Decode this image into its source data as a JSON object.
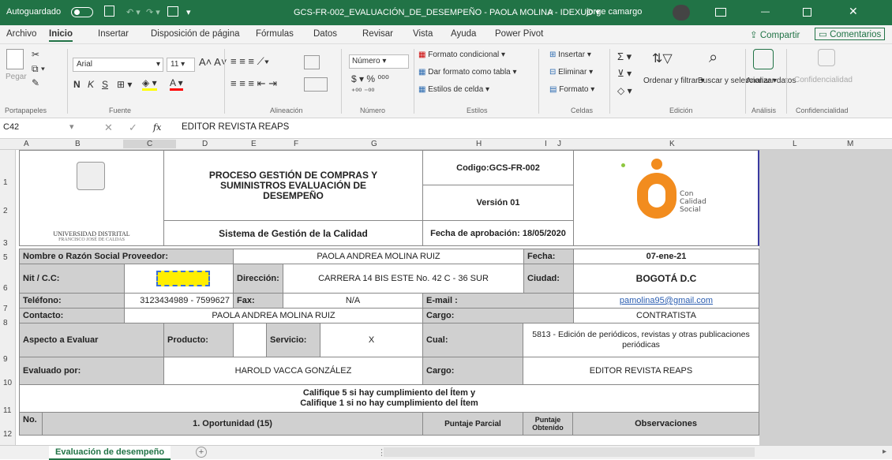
{
  "titlebar": {
    "autosave": "Autoguardado",
    "filename": "GCS-FR-002_EVALUACIÓN_DE_DESEMPEÑO - PAOLA MOLINA - IDEXUD ▾",
    "user": "jorge camargo",
    "bg": "#217346"
  },
  "menu": {
    "items": [
      "Archivo",
      "Inicio",
      "Insertar",
      "Disposición de página",
      "Fórmulas",
      "Datos",
      "Revisar",
      "Vista",
      "Ayuda",
      "Power Pivot"
    ],
    "share": "Compartir",
    "comments": "Comentarios"
  },
  "ribbon": {
    "paste": "Pegar",
    "font": "Arial",
    "size": "11",
    "bold": "N",
    "italic": "K",
    "underline": "S",
    "numfmt": "Número",
    "cond": "Formato condicional ▾",
    "astable": "Dar formato como tabla ▾",
    "styles": "Estilos de celda ▾",
    "insert": "Insertar ▾",
    "delete": "Eliminar ▾",
    "format": "Formato ▾",
    "sort": "Ordenar y filtrar ▾",
    "find": "Buscar y seleccionar ▾",
    "analyze": "Analizar datos",
    "conf": "Confidencialidad",
    "groups": [
      "Portapapeles",
      "Fuente",
      "Alineación",
      "Número",
      "Estilos",
      "Celdas",
      "Edición",
      "Análisis",
      "Confidencialidad"
    ]
  },
  "formula": {
    "cell": "C42",
    "fx": "fx",
    "value": "EDITOR REVISTA REAPS"
  },
  "columns": [
    "A",
    "B",
    "C",
    "D",
    "E",
    "F",
    "G",
    "H",
    "I",
    "J",
    "K",
    "L",
    "M"
  ],
  "rows": [
    "1",
    "2",
    "3",
    "5",
    "6",
    "7",
    "8",
    "9",
    "10",
    "11",
    "12"
  ],
  "sheet": {
    "univ1": "UNIVERSIDAD DISTRITAL",
    "univ2": "FRANCISCO JOSÉ DE CALDAS",
    "proc": "PROCESO GESTIÓN DE COMPRAS Y SUMINISTROS EVALUACIÓN DE DESEMPEÑO",
    "sgc": "Sistema de Gestión de la Calidad",
    "code": "Codigo:GCS-FR-002",
    "ver": "Versión 01",
    "date": "Fecha de aprobación: 18/05/2020",
    "logo_text": "Con Calidad Social",
    "l_name": "Nombre o Razón Social Proveedor:",
    "name": "PAOLA ANDREA MOLINA RUIZ",
    "l_fecha": "Fecha:",
    "fecha": "07-ene-21",
    "l_nit": "Nit / C.C:",
    "l_dir": "Dirección:",
    "dir": "CARRERA 14 BIS ESTE No. 42 C - 36 SUR",
    "l_city": "Ciudad:",
    "city": "BOGOTÁ D.C",
    "l_tel": "Teléfono:",
    "tel": "3123434989 - 7599627",
    "l_fax": "Fax:",
    "fax": "N/A",
    "l_mail": "E-mail :",
    "mail": "pamolina95@gmail.com",
    "l_contact": "Contacto:",
    "contact": "PAOLA ANDREA MOLINA RUIZ",
    "l_cargo": "Cargo:",
    "cargo1": "CONTRATISTA",
    "l_aspect": "Aspecto a Evaluar",
    "l_prod": "Producto:",
    "l_serv": "Servicio:",
    "serv": "X",
    "l_cual": "Cual:",
    "cual": "5813 - Edición de periódicos, revistas y otras publicaciones periódicas",
    "l_eval": "Evaluado por:",
    "eval": "HAROLD VACCA GONZÁLEZ",
    "cargo2": "EDITOR REVISTA REAPS",
    "note1": "Califique 5 si hay cumplimiento del Ítem y",
    "note2": "Califique 1 si no hay cumplimiento del Ítem",
    "h_no": "No.",
    "h_op": "1. Oportunidad (15)",
    "h_pp": "Puntaje Parcial",
    "h_po": "Puntaje Obtenido",
    "h_obs": "Observaciones"
  },
  "tab": {
    "name": "Evaluación de desempeño"
  }
}
